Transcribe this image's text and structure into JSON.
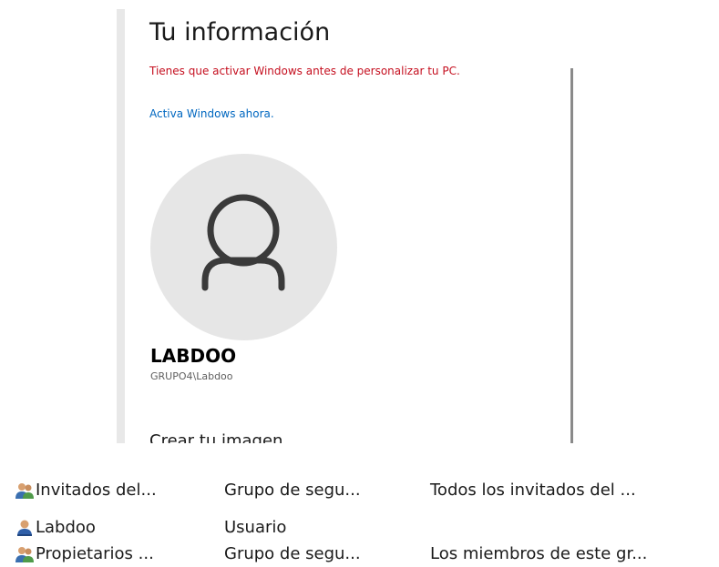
{
  "settings": {
    "title": "Tu información",
    "activation_warning": "Tienes que activar Windows antes de personalizar tu PC.",
    "activate_link": "Activa Windows ahora.",
    "user_name": "LABDOO",
    "user_account": "GRUPO4\\Labdoo",
    "create_picture_heading": "Crear tu imagen",
    "colors": {
      "warning": "#c50f1f",
      "link": "#0067c0",
      "avatar_bg": "#e6e6e6",
      "avatar_glyph": "#3a3a3a"
    }
  },
  "members": {
    "rows": [
      {
        "name": "Invitados del...",
        "type": "Grupo de segu...",
        "description": "Todos los invitados del ...",
        "icon": "group-icon"
      },
      {
        "name": "Labdoo",
        "type": "Usuario",
        "description": "",
        "icon": "user-icon"
      },
      {
        "name": "Propietarios ...",
        "type": "Grupo de segu...",
        "description": "Los miembros de este gr...",
        "icon": "group-icon"
      }
    ]
  }
}
